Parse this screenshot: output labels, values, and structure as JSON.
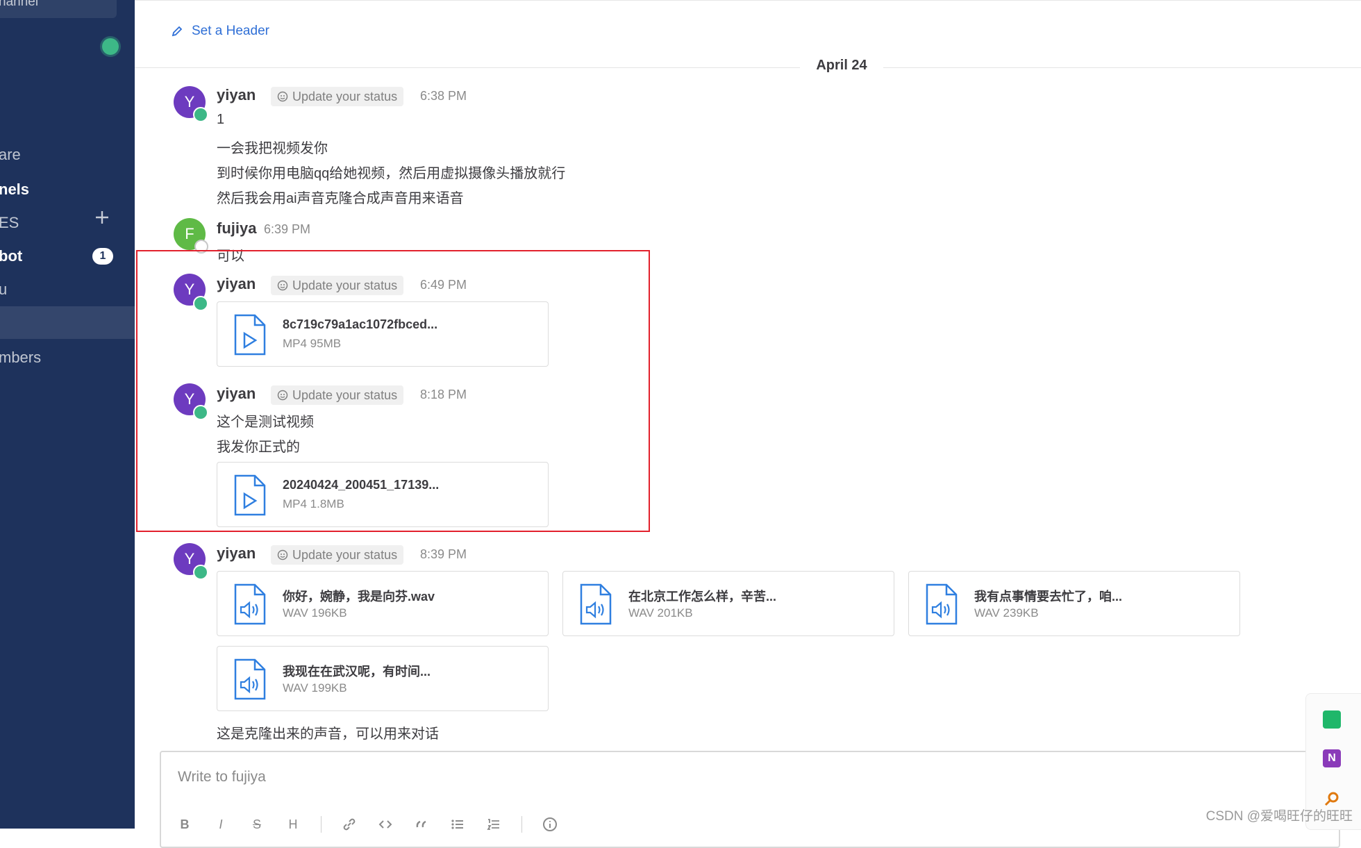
{
  "sidebar": {
    "channel_label": "hannel",
    "items": [
      {
        "label": "are"
      },
      {
        "label": "nels"
      },
      {
        "label": "ES"
      },
      {
        "label": "bot",
        "badge": "1"
      },
      {
        "label": "u"
      },
      {
        "label": "mbers"
      }
    ]
  },
  "header": {
    "set_header_label": "Set a Header"
  },
  "date_separator": "April 24",
  "messages": [
    {
      "avatar": "Y",
      "user": "yiyan",
      "status_label": "Update your status",
      "time": "6:38 PM",
      "lines": [
        "1",
        "一会我把视频发你",
        "到时候你用电脑qq给她视频，然后用虚拟摄像头播放就行",
        "然后我会用ai声音克隆合成声音用来语音"
      ]
    },
    {
      "avatar": "F",
      "user": "fujiya",
      "time": "6:39 PM",
      "lines": [
        "可以"
      ]
    },
    {
      "avatar": "Y",
      "user": "yiyan",
      "status_label": "Update your status",
      "time": "6:49 PM",
      "files": [
        {
          "name": "8c719c79a1ac1072fbced...",
          "meta": "MP4 95MB",
          "icon": "video-file-icon"
        }
      ]
    },
    {
      "avatar": "Y",
      "user": "yiyan",
      "status_label": "Update your status",
      "time": "8:18 PM",
      "lines": [
        "这个是测试视频",
        "我发你正式的"
      ],
      "files": [
        {
          "name": "20240424_200451_17139...",
          "meta": "MP4 1.8MB",
          "icon": "video-file-icon"
        }
      ]
    },
    {
      "avatar": "Y",
      "user": "yiyan",
      "status_label": "Update your status",
      "time": "8:39 PM",
      "files": [
        {
          "name": "你好，婉静，我是向芬.wav",
          "meta": "WAV 196KB",
          "icon": "audio-file-icon"
        },
        {
          "name": "在北京工作怎么样，辛苦...",
          "meta": "WAV 201KB",
          "icon": "audio-file-icon"
        },
        {
          "name": "我有点事情要去忙了，咱...",
          "meta": "WAV 239KB",
          "icon": "audio-file-icon"
        },
        {
          "name": "我现在在武汉呢，有时间...",
          "meta": "WAV 199KB",
          "icon": "audio-file-icon"
        }
      ],
      "lines": [
        "这是克隆出来的声音，可以用来对话"
      ]
    }
  ],
  "composer": {
    "placeholder": "Write to fujiya",
    "formatting": [
      "B",
      "I",
      "S",
      "H",
      "link",
      "code",
      "quote",
      "bullets",
      "numbered",
      "emoji"
    ]
  },
  "watermark": "CSDN @爱喝旺仔的旺旺",
  "colors": {
    "sidebar": "#1e325c",
    "accent": "#2f6fd6",
    "online": "#3db887",
    "highlight": "#e2202c",
    "avatar_y": "#6d3bbf",
    "avatar_f": "#5fba46"
  }
}
